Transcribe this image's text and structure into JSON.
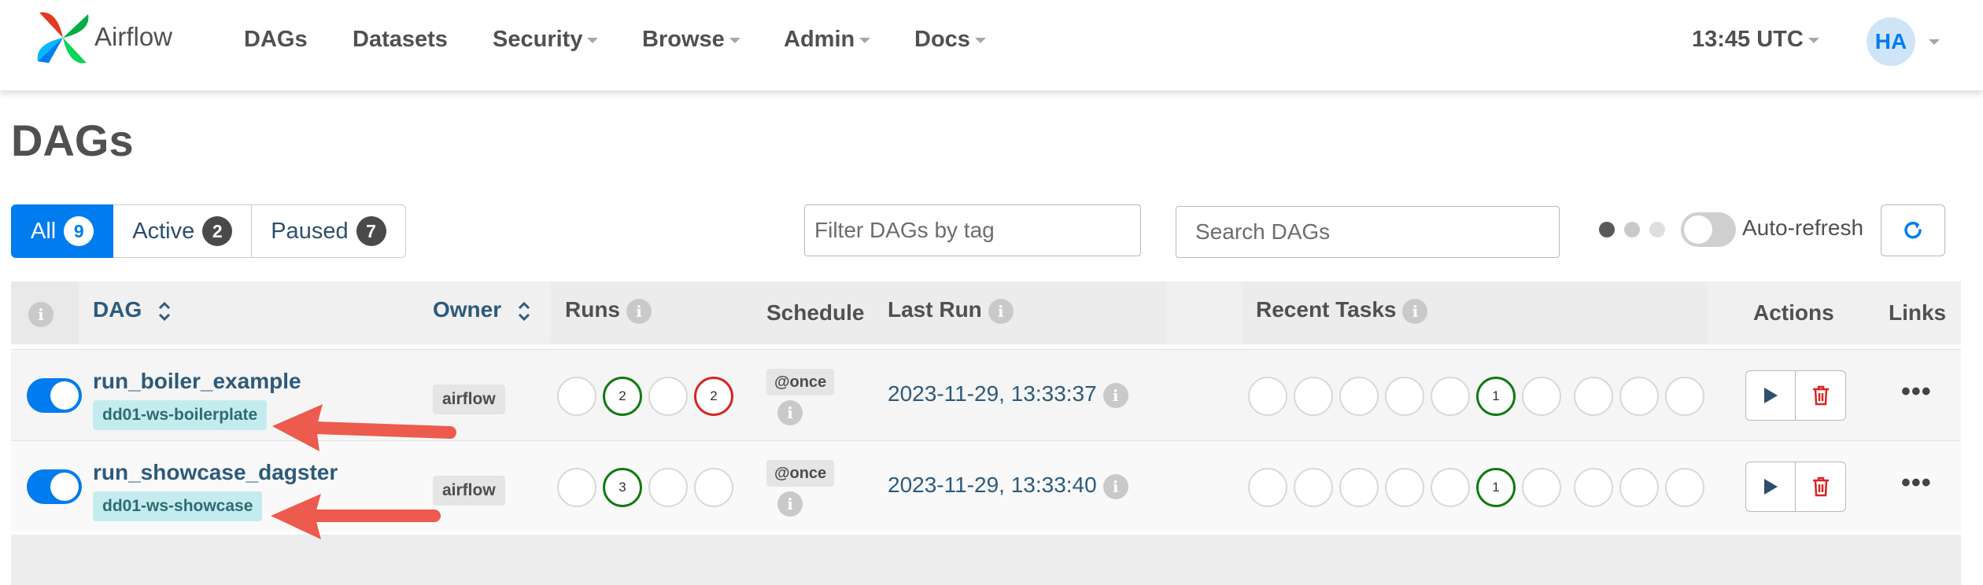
{
  "nav": {
    "brand": "Airflow",
    "items": [
      {
        "label": "DAGs",
        "caret": false
      },
      {
        "label": "Datasets",
        "caret": false
      },
      {
        "label": "Security",
        "caret": true
      },
      {
        "label": "Browse",
        "caret": true
      },
      {
        "label": "Admin",
        "caret": true
      },
      {
        "label": "Docs",
        "caret": true
      }
    ],
    "clock": "13:45 UTC",
    "avatar": "HA"
  },
  "page_title": "DAGs",
  "filters": {
    "all": {
      "label": "All",
      "count": "9"
    },
    "active": {
      "label": "Active",
      "count": "2"
    },
    "paused": {
      "label": "Paused",
      "count": "7"
    }
  },
  "tag_filter": {
    "placeholder": "Filter DAGs by tag"
  },
  "search": {
    "placeholder": "Search DAGs"
  },
  "auto_refresh": {
    "label": "Auto-refresh",
    "enabled": false
  },
  "columns": {
    "dag": "DAG",
    "owner": "Owner",
    "runs": "Runs",
    "schedule": "Schedule",
    "last_run": "Last Run",
    "recent_tasks": "Recent Tasks",
    "actions": "Actions",
    "links": "Links"
  },
  "rows": [
    {
      "name": "run_boiler_example",
      "tag": "dd01-ws-boilerplate",
      "owner": "airflow",
      "runs": [
        "",
        "2",
        "",
        "2"
      ],
      "schedule": "@once",
      "last_run": "2023-11-29, 13:33:37",
      "recent_task_count": "1",
      "active": true
    },
    {
      "name": "run_showcase_dagster",
      "tag": "dd01-ws-showcase",
      "owner": "airflow",
      "runs": [
        "",
        "3",
        "",
        ""
      ],
      "schedule": "@once",
      "last_run": "2023-11-29, 13:33:40",
      "recent_task_count": "1",
      "active": true
    }
  ],
  "colors": {
    "primary": "#017cee",
    "success": "#117a11",
    "failed": "#d92424",
    "annotation_arrow": "#ec5b4d"
  }
}
